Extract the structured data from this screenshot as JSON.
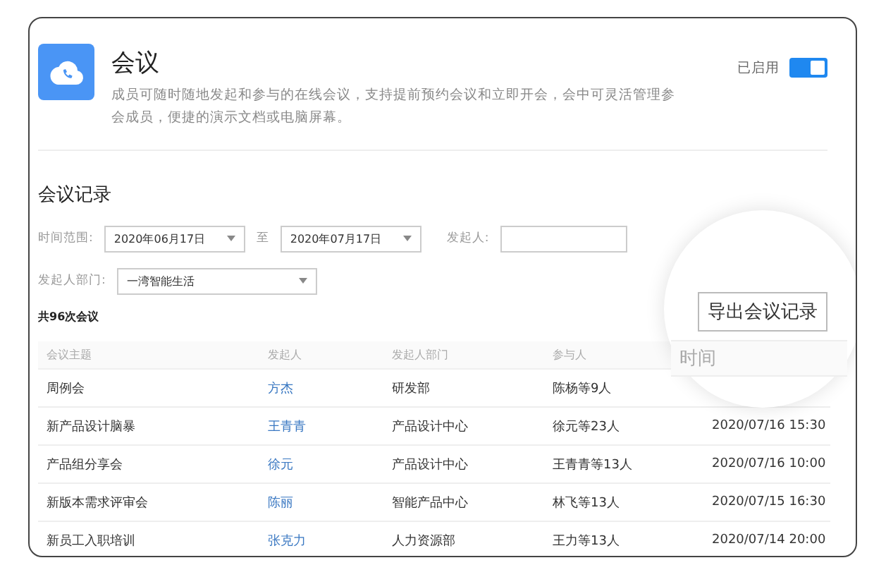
{
  "app": {
    "title": "会议",
    "description": "成员可随时随地发起和参与的在线会议，支持提前预约会议和立即开会，会中可灵活管理参会成员，便捷的演示文档或电脑屏幕。",
    "status_label": "已启用",
    "enabled": true
  },
  "records": {
    "title": "会议记录",
    "filters": {
      "range_label": "时间范围:",
      "start_date": "2020年06月17日",
      "separator": "至",
      "end_date": "2020年07月17日",
      "initiator_label": "发起人:",
      "department_label": "发起人部门:",
      "department": "一湾智能生活"
    },
    "count": "共96次会议",
    "magnifier": {
      "export_button": "导出会议记录",
      "column_header": "时间"
    },
    "table": {
      "columns": [
        "会议主题",
        "发起人",
        "发起人部门",
        "参与人"
      ],
      "rows": [
        {
          "topic": "周例会",
          "initiator": "方杰",
          "department": "研发部",
          "participants": "陈杨等9人"
        },
        {
          "topic": "新产品设计脑暴",
          "initiator": "王青青",
          "department": "产品设计中心",
          "participants": "徐元等23人",
          "time": "2020/07/16 15:30"
        },
        {
          "topic": "产品组分享会",
          "initiator": "徐元",
          "department": "产品设计中心",
          "participants": "王青青等13人",
          "time": "2020/07/16 10:00"
        },
        {
          "topic": "新版本需求评审会",
          "initiator": "陈丽",
          "department": "智能产品中心",
          "participants": "林飞等13人",
          "time": "2020/07/15 16:30"
        },
        {
          "topic": "新员工入职培训",
          "initiator": "张克力",
          "department": "人力资源部",
          "participants": "王力等13人",
          "time": "2020/07/14 20:00"
        }
      ]
    }
  }
}
